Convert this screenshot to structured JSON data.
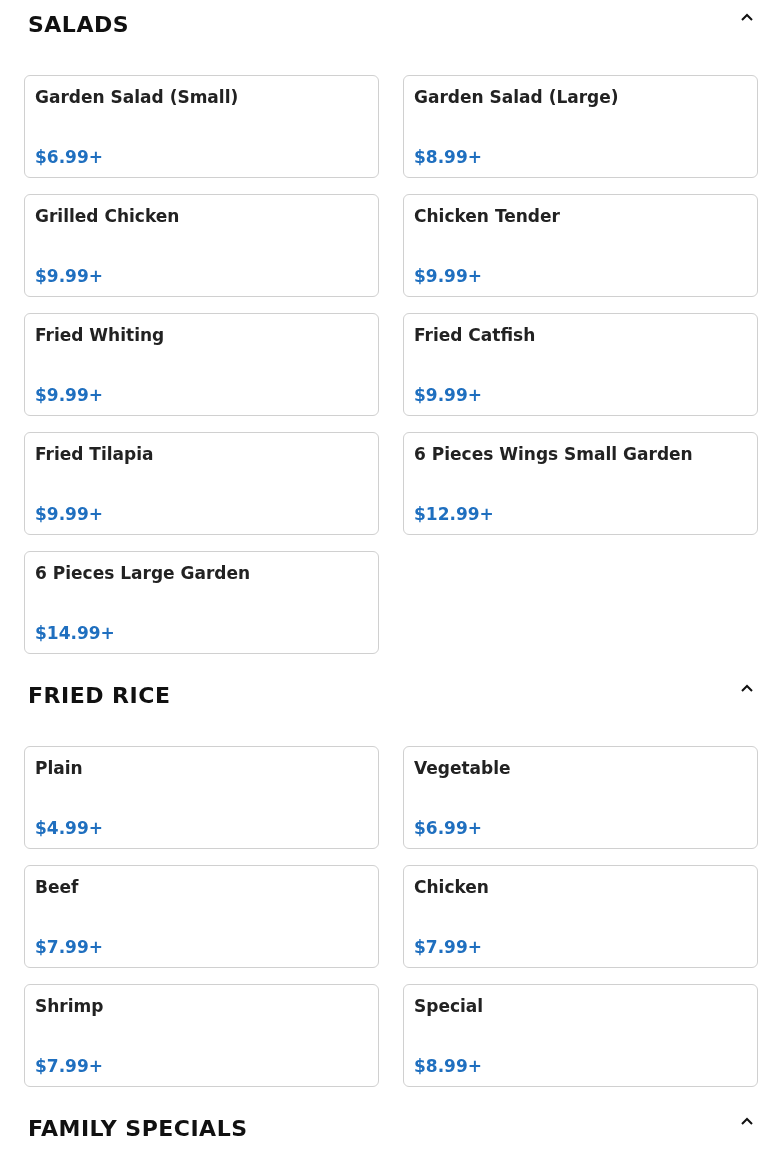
{
  "sections": [
    {
      "title": "SALADS",
      "expanded": true,
      "items": [
        {
          "name": "Garden Salad (Small)",
          "price": "$6.99+"
        },
        {
          "name": "Garden Salad (Large)",
          "price": "$8.99+"
        },
        {
          "name": "Grilled Chicken",
          "price": "$9.99+"
        },
        {
          "name": "Chicken Tender",
          "price": "$9.99+"
        },
        {
          "name": "Fried Whiting",
          "price": "$9.99+"
        },
        {
          "name": "Fried Catfish",
          "price": "$9.99+"
        },
        {
          "name": "Fried Tilapia",
          "price": "$9.99+"
        },
        {
          "name": "6 Pieces Wings Small Garden",
          "price": "$12.99+"
        },
        {
          "name": "6 Pieces Large Garden",
          "price": "$14.99+"
        }
      ]
    },
    {
      "title": "FRIED RICE",
      "expanded": true,
      "items": [
        {
          "name": "Plain",
          "price": "$4.99+"
        },
        {
          "name": "Vegetable",
          "price": "$6.99+"
        },
        {
          "name": "Beef",
          "price": "$7.99+"
        },
        {
          "name": "Chicken",
          "price": "$7.99+"
        },
        {
          "name": "Shrimp",
          "price": "$7.99+"
        },
        {
          "name": "Special",
          "price": "$8.99+"
        }
      ]
    },
    {
      "title": "FAMILY SPECIALS",
      "expanded": true
    }
  ]
}
